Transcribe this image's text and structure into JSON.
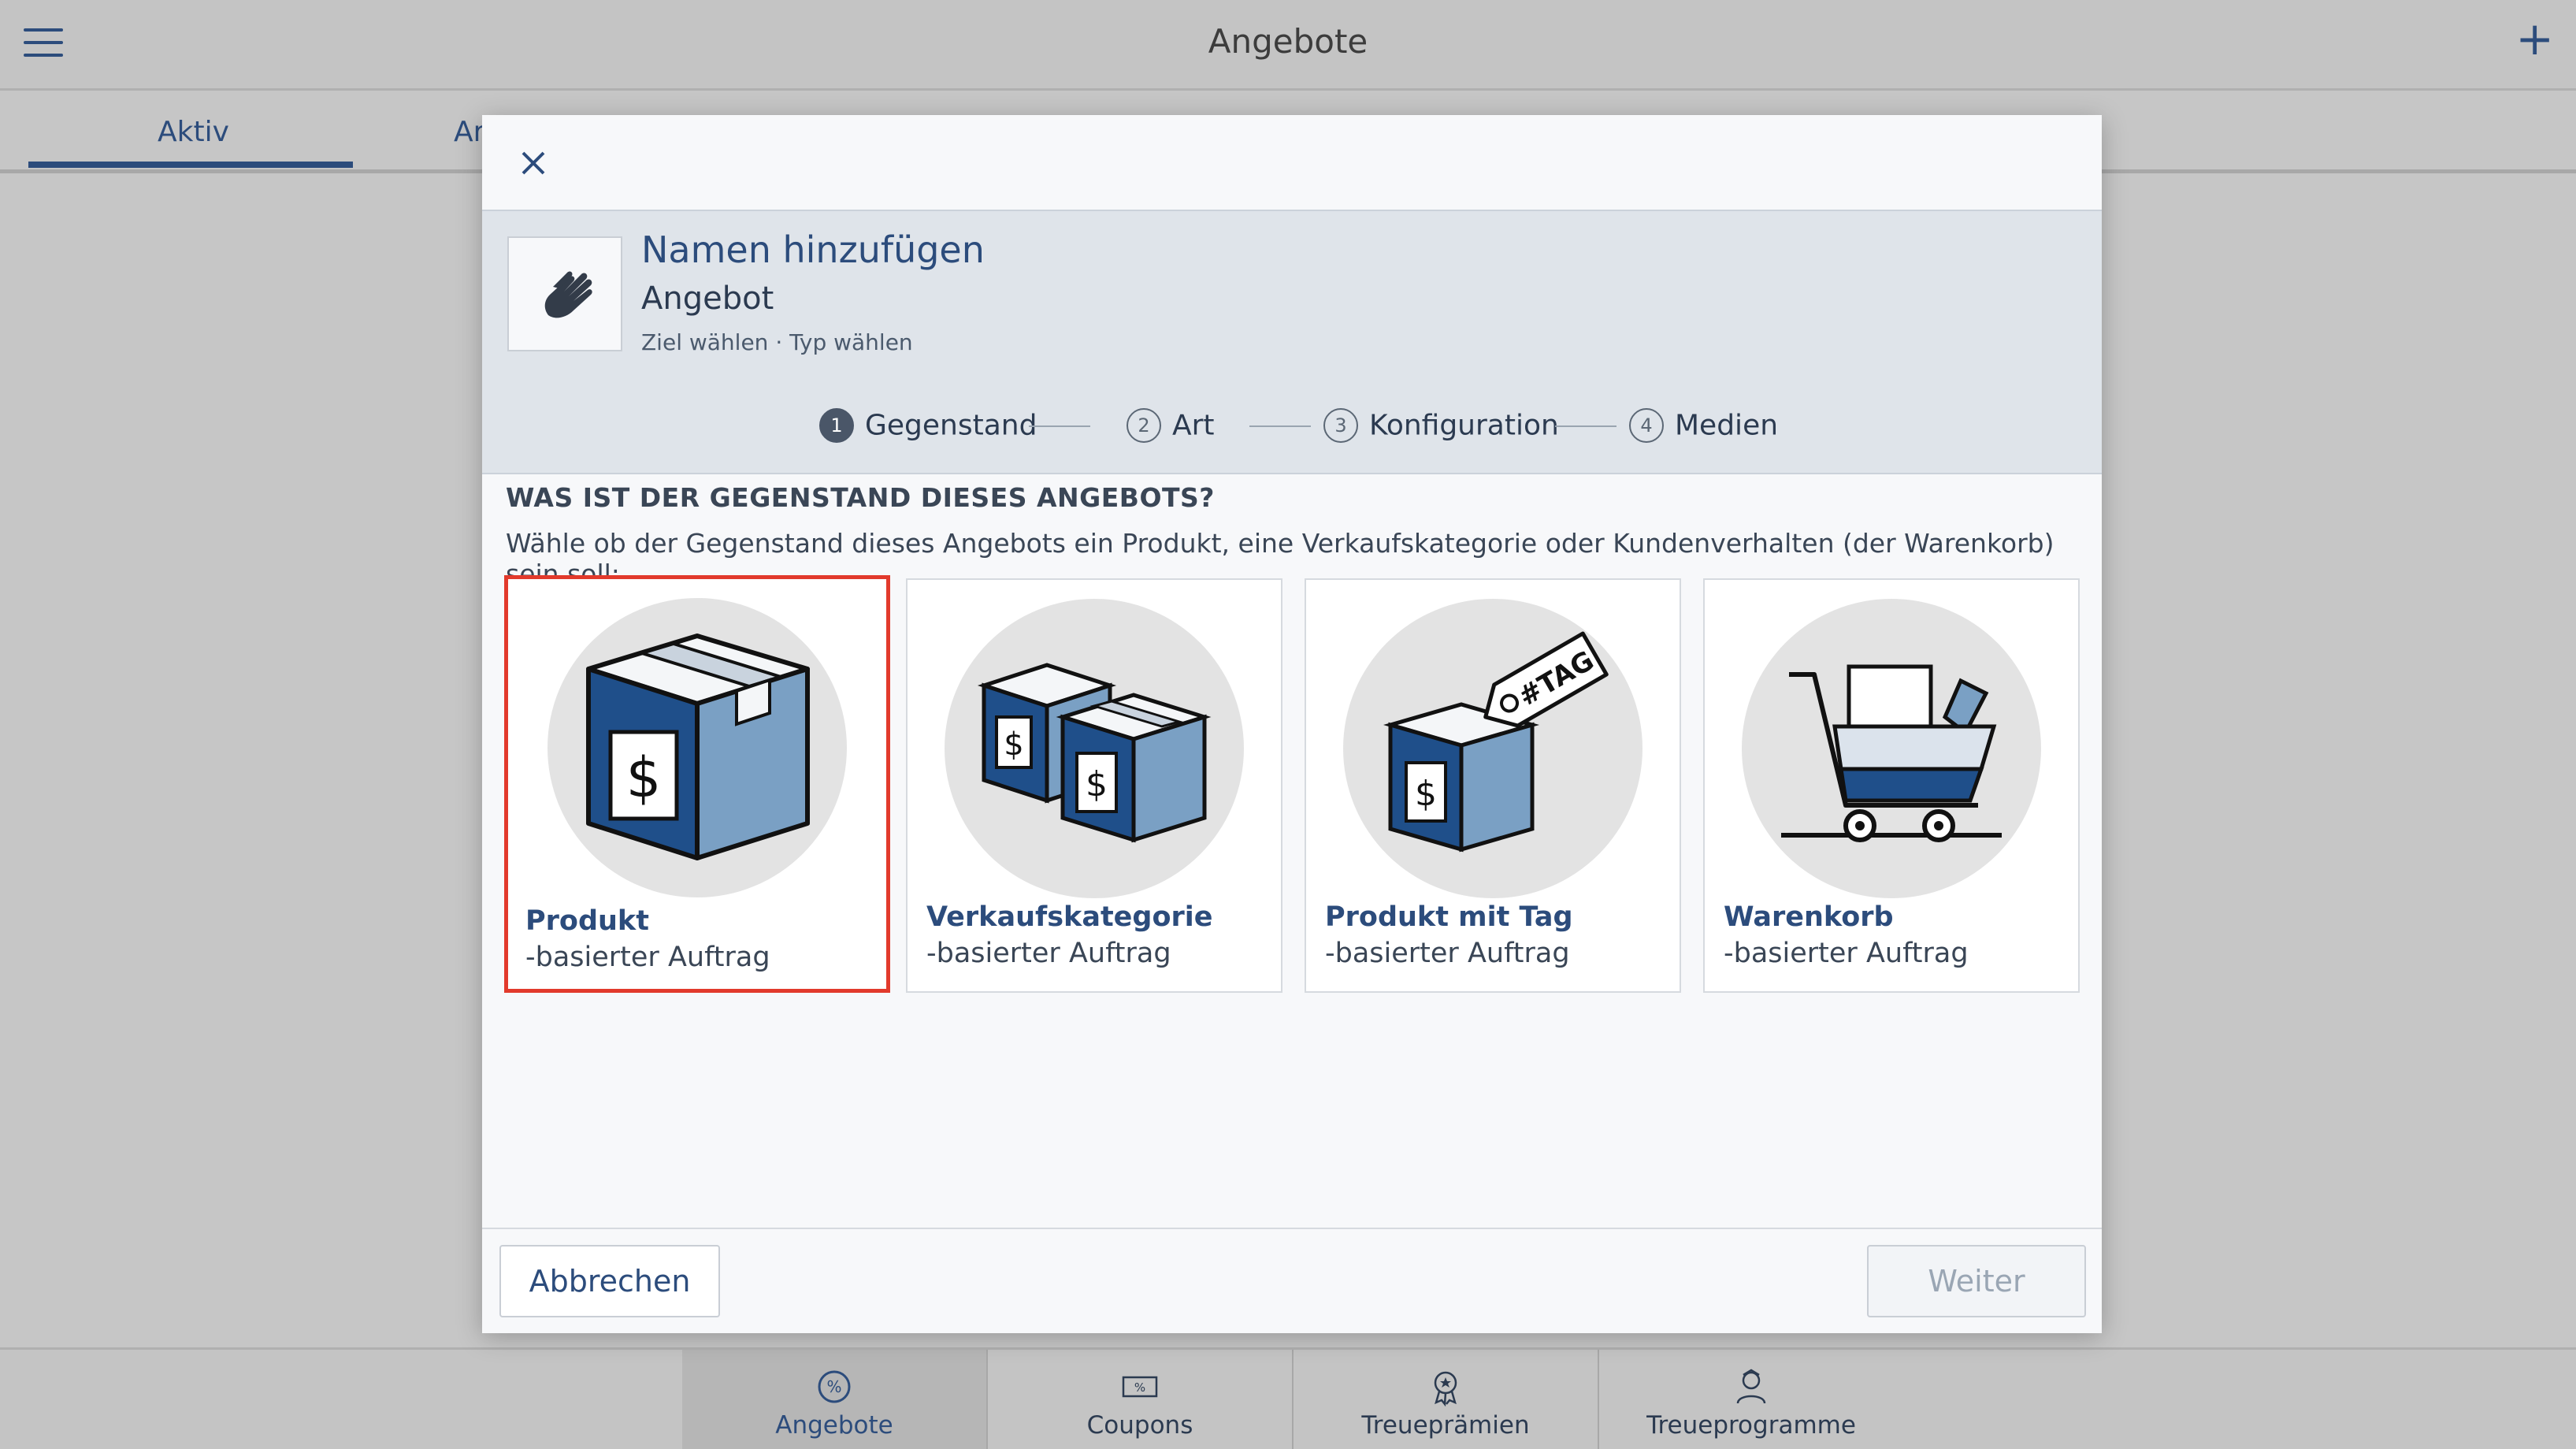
{
  "header": {
    "title": "Angebote"
  },
  "tabs": {
    "active": "Aktiv",
    "second_partial": "Ar"
  },
  "modal": {
    "title": "Namen hinzufügen",
    "subtitle": "Angebot",
    "breadcrumb": "Ziel wählen · Typ wählen",
    "steps": [
      {
        "num": "1",
        "label": "Gegenstand",
        "active": true
      },
      {
        "num": "2",
        "label": "Art",
        "active": false
      },
      {
        "num": "3",
        "label": "Konfiguration",
        "active": false
      },
      {
        "num": "4",
        "label": "Medien",
        "active": false
      }
    ],
    "question": "WAS IST DER GEGENSTAND DIESES ANGEBOTS?",
    "description": "Wähle ob der Gegenstand dieses Angebots ein Produkt, eine Verkaufskategorie oder Kundenverhalten (der Warenkorb) sein soll:",
    "options": [
      {
        "title": "Produkt",
        "subtitle": "-basierter Auftrag",
        "selected": true,
        "icon": "product-box-icon"
      },
      {
        "title": "Verkaufskategorie",
        "subtitle": "-basierter Auftrag",
        "selected": false,
        "icon": "category-boxes-icon"
      },
      {
        "title": "Produkt mit Tag",
        "subtitle": "-basierter Auftrag",
        "selected": false,
        "icon": "tagged-product-icon"
      },
      {
        "title": "Warenkorb",
        "subtitle": "-basierter Auftrag",
        "selected": false,
        "icon": "shopping-cart-icon"
      }
    ],
    "cancel_label": "Abbrechen",
    "next_label": "Weiter"
  },
  "bottom_nav": [
    {
      "label": "Angebote",
      "icon": "offers-percent-icon",
      "selected": true
    },
    {
      "label": "Coupons",
      "icon": "coupon-icon",
      "selected": false
    },
    {
      "label": "Treueprämien",
      "icon": "loyalty-reward-icon",
      "selected": false
    },
    {
      "label": "Treueprogramme",
      "icon": "loyalty-program-icon",
      "selected": false
    }
  ],
  "colors": {
    "accent": "#2c4c7c",
    "selection": "#e23a2c",
    "icon_light": "#7aa0c4",
    "icon_dark": "#1f4f8a"
  }
}
